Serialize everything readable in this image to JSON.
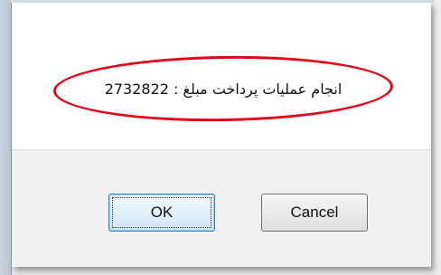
{
  "dialog": {
    "message": "انجام عملیات پرداخت مبلغ : 2732822",
    "ok_label": "OK",
    "cancel_label": "Cancel"
  },
  "colors": {
    "highlight": "#e2061a",
    "ok_border": "#3c7fb1"
  }
}
